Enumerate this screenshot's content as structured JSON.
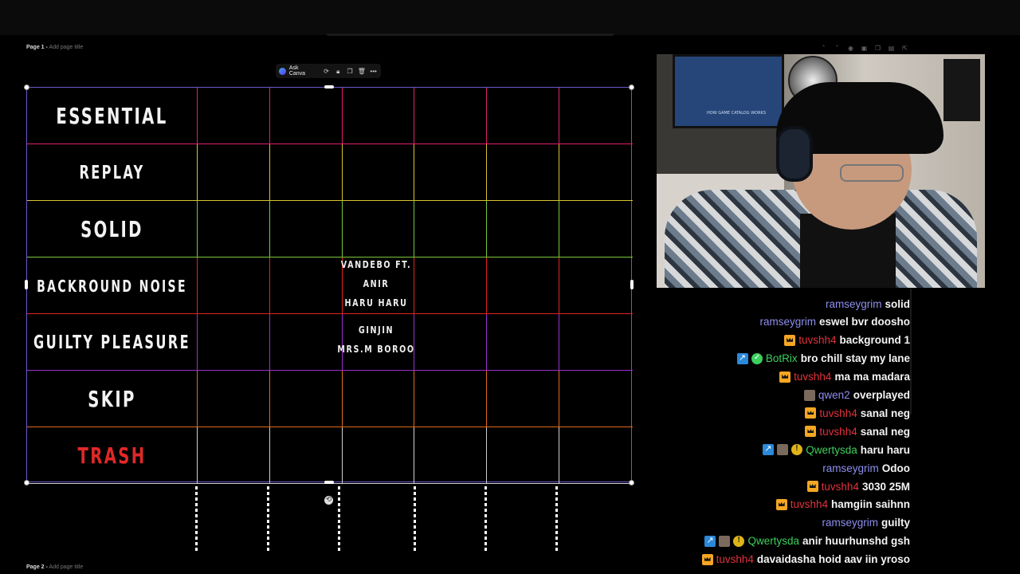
{
  "pages": {
    "page1_num": "Page 1 -",
    "page1_hint": "Add page title",
    "page2_num": "Page 2 -",
    "page2_hint": "Add page title"
  },
  "toolbar": {
    "ask_label": "Ask Canva"
  },
  "tiers": [
    {
      "label": "ESSENTIAL",
      "color": "#e0206e"
    },
    {
      "label": "REPLAY",
      "color": "#d8c430"
    },
    {
      "label": "SOLID",
      "color": "#7ac93a"
    },
    {
      "label": "BACKROUND NOISE",
      "color": "#e02424"
    },
    {
      "label": "GUILTY PLEASURE",
      "color": "#9b2fd0"
    },
    {
      "label": "SKIP",
      "color": "#e06a1c"
    },
    {
      "label": "TRASH",
      "color": "#d0d0d0"
    }
  ],
  "entries": {
    "noise_line1": "VANDEBO FT.",
    "noise_line2": "ANIR",
    "noise_line3": "HARU HARU",
    "guilty_line1": "GINJIN",
    "guilty_line2": "MRS.M BOROO"
  },
  "chat": [
    {
      "user": "ramseygrim",
      "color": "#8e8ef0",
      "badges": [],
      "msg": "solid"
    },
    {
      "user": "ramseygrim",
      "color": "#8e8ef0",
      "badges": [],
      "msg": "eswel bvr doosho"
    },
    {
      "user": "tuvshh4",
      "color": "#e0323c",
      "badges": [
        "crown"
      ],
      "msg": "background 1"
    },
    {
      "user": "BotRix",
      "color": "#3ccf5d",
      "badges": [
        "blue",
        "green"
      ],
      "msg": "bro chill stay my lane"
    },
    {
      "user": "tuvshh4",
      "color": "#e0323c",
      "badges": [
        "crown"
      ],
      "msg": "ma ma madara"
    },
    {
      "user": "qwen2",
      "color": "#8e8ef0",
      "badges": [
        "avatar"
      ],
      "msg": "overplayed"
    },
    {
      "user": "tuvshh4",
      "color": "#e0323c",
      "badges": [
        "crown"
      ],
      "msg": "sanal neg"
    },
    {
      "user": "tuvshh4",
      "color": "#e0323c",
      "badges": [
        "crown"
      ],
      "msg": "sanal neg"
    },
    {
      "user": "Qwertysda",
      "color": "#3ccf5d",
      "badges": [
        "blue",
        "avatar",
        "coin"
      ],
      "msg": "haru haru"
    },
    {
      "user": "ramseygrim",
      "color": "#8e8ef0",
      "badges": [],
      "msg": "Odoo"
    },
    {
      "user": "tuvshh4",
      "color": "#e0323c",
      "badges": [
        "crown"
      ],
      "msg": "3030 25M"
    },
    {
      "user": "tuvshh4",
      "color": "#e0323c",
      "badges": [
        "crown"
      ],
      "msg": "hamgiin saihnn"
    },
    {
      "user": "ramseygrim",
      "color": "#8e8ef0",
      "badges": [],
      "msg": "guilty"
    },
    {
      "user": "Qwertysda",
      "color": "#3ccf5d",
      "badges": [
        "blue",
        "avatar",
        "coin"
      ],
      "msg": "anir huurhunshd gsh"
    },
    {
      "user": "tuvshh4",
      "color": "#e0323c",
      "badges": [
        "crown"
      ],
      "msg": "davaidasha hoid aav iin yroso"
    }
  ],
  "webcam": {
    "monitor_text": "HOW GAME CATALOG WORKS"
  }
}
